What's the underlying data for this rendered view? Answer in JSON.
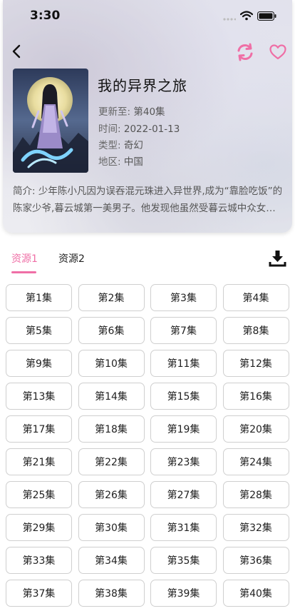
{
  "status_bar": {
    "time": "3:30"
  },
  "detail": {
    "title": "我的异界之旅",
    "meta": [
      {
        "label": "更新至:",
        "value": "第40集"
      },
      {
        "label": "时间:",
        "value": "2022-01-13"
      },
      {
        "label": "类型:",
        "value": "奇幻"
      },
      {
        "label": "地区:",
        "value": "中国"
      }
    ],
    "description": "简介: 少年陈小凡因为误吞混元珠进入异世界,成为“靠脸吃饭”的陈家少爷,暮云城第一美男子。他发现他虽然受暮云城中众女子的追捧和喜爱,却是个无法修炼的废柴。为了回到原来的世界..."
  },
  "tabs": [
    {
      "label": "资源1",
      "active": true
    },
    {
      "label": "资源2",
      "active": false
    }
  ],
  "episodes": [
    "第1集",
    "第2集",
    "第3集",
    "第4集",
    "第5集",
    "第6集",
    "第7集",
    "第8集",
    "第9集",
    "第10集",
    "第11集",
    "第12集",
    "第13集",
    "第14集",
    "第15集",
    "第16集",
    "第17集",
    "第18集",
    "第19集",
    "第20集",
    "第21集",
    "第22集",
    "第23集",
    "第24集",
    "第25集",
    "第26集",
    "第27集",
    "第28集",
    "第29集",
    "第30集",
    "第31集",
    "第32集",
    "第33集",
    "第34集",
    "第35集",
    "第36集",
    "第37集",
    "第38集",
    "第39集",
    "第40集"
  ],
  "icons": {
    "back": "chevron-left-icon",
    "refresh": "refresh-icon",
    "favorite": "heart-outline-icon",
    "download": "download-icon"
  },
  "colors": {
    "accent": "#ef6fa6"
  }
}
